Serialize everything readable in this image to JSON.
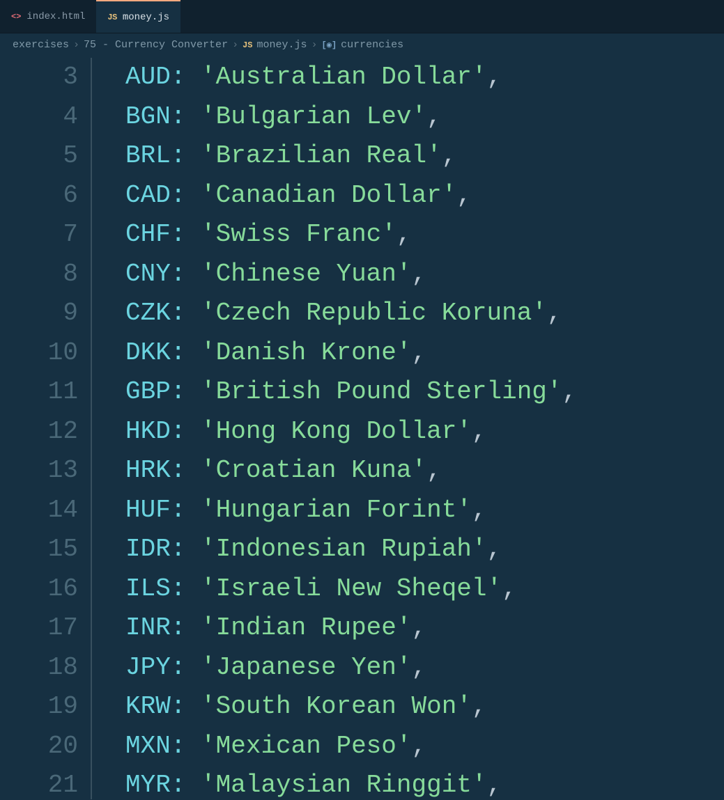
{
  "tabs": [
    {
      "icon": "<>",
      "iconClass": "html",
      "label": "index.html",
      "active": false
    },
    {
      "icon": "JS",
      "iconClass": "js",
      "label": "money.js",
      "active": true
    }
  ],
  "breadcrumbs": [
    {
      "type": "text",
      "label": "exercises"
    },
    {
      "type": "sep"
    },
    {
      "type": "text",
      "label": "75 - Currency Converter"
    },
    {
      "type": "sep"
    },
    {
      "type": "icon",
      "iconClass": "js",
      "icon": "JS"
    },
    {
      "type": "text",
      "label": "money.js"
    },
    {
      "type": "sep"
    },
    {
      "type": "icon",
      "iconClass": "sym",
      "icon": "[◉]"
    },
    {
      "type": "text",
      "label": "currencies"
    }
  ],
  "code_lines": [
    {
      "ln": "3",
      "key": "AUD",
      "value": "Australian Dollar"
    },
    {
      "ln": "4",
      "key": "BGN",
      "value": "Bulgarian Lev"
    },
    {
      "ln": "5",
      "key": "BRL",
      "value": "Brazilian Real"
    },
    {
      "ln": "6",
      "key": "CAD",
      "value": "Canadian Dollar"
    },
    {
      "ln": "7",
      "key": "CHF",
      "value": "Swiss Franc"
    },
    {
      "ln": "8",
      "key": "CNY",
      "value": "Chinese Yuan"
    },
    {
      "ln": "9",
      "key": "CZK",
      "value": "Czech Republic Koruna"
    },
    {
      "ln": "10",
      "key": "DKK",
      "value": "Danish Krone"
    },
    {
      "ln": "11",
      "key": "GBP",
      "value": "British Pound Sterling"
    },
    {
      "ln": "12",
      "key": "HKD",
      "value": "Hong Kong Dollar"
    },
    {
      "ln": "13",
      "key": "HRK",
      "value": "Croatian Kuna"
    },
    {
      "ln": "14",
      "key": "HUF",
      "value": "Hungarian Forint"
    },
    {
      "ln": "15",
      "key": "IDR",
      "value": "Indonesian Rupiah"
    },
    {
      "ln": "16",
      "key": "ILS",
      "value": "Israeli New Sheqel"
    },
    {
      "ln": "17",
      "key": "INR",
      "value": "Indian Rupee"
    },
    {
      "ln": "18",
      "key": "JPY",
      "value": "Japanese Yen"
    },
    {
      "ln": "19",
      "key": "KRW",
      "value": "South Korean Won"
    },
    {
      "ln": "20",
      "key": "MXN",
      "value": "Mexican Peso"
    },
    {
      "ln": "21",
      "key": "MYR",
      "value": "Malaysian Ringgit"
    }
  ]
}
